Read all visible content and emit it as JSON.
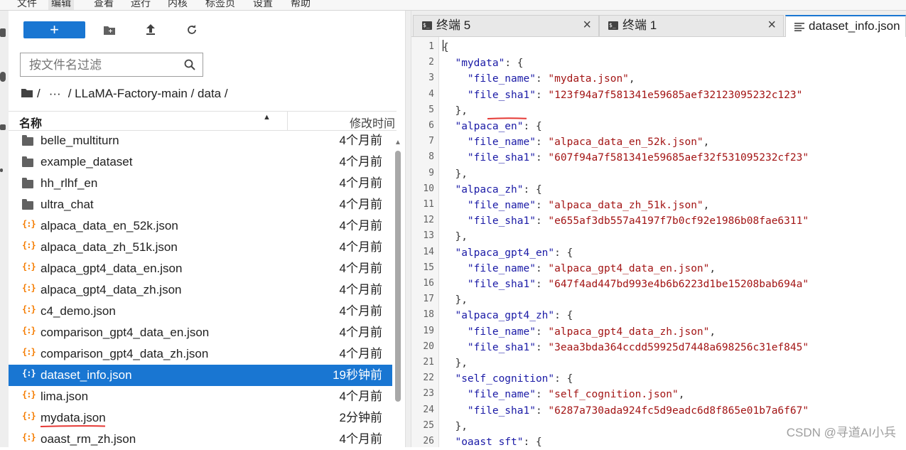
{
  "menubar": {
    "items": [
      "文件",
      "编辑",
      "查看",
      "运行",
      "内核",
      "标签页",
      "设置",
      "帮助"
    ],
    "active_index": 1
  },
  "toolbar": {
    "new_label": "+"
  },
  "filter": {
    "placeholder": "按文件名过滤"
  },
  "breadcrumb": {
    "sep1": "/",
    "ellipsis": "···",
    "path": "/ LLaMA-Factory-main / data /"
  },
  "list_header": {
    "name": "名称",
    "modified": "修改时间"
  },
  "files": [
    {
      "name": "belle_multiturn",
      "time": "4个月前",
      "type": "folder"
    },
    {
      "name": "example_dataset",
      "time": "4个月前",
      "type": "folder"
    },
    {
      "name": "hh_rlhf_en",
      "time": "4个月前",
      "type": "folder"
    },
    {
      "name": "ultra_chat",
      "time": "4个月前",
      "type": "folder"
    },
    {
      "name": "alpaca_data_en_52k.json",
      "time": "4个月前",
      "type": "json"
    },
    {
      "name": "alpaca_data_zh_51k.json",
      "time": "4个月前",
      "type": "json"
    },
    {
      "name": "alpaca_gpt4_data_en.json",
      "time": "4个月前",
      "type": "json"
    },
    {
      "name": "alpaca_gpt4_data_zh.json",
      "time": "4个月前",
      "type": "json"
    },
    {
      "name": "c4_demo.json",
      "time": "4个月前",
      "type": "json"
    },
    {
      "name": "comparison_gpt4_data_en.json",
      "time": "4个月前",
      "type": "json"
    },
    {
      "name": "comparison_gpt4_data_zh.json",
      "time": "4个月前",
      "type": "json"
    },
    {
      "name": "dataset_info.json",
      "time": "19秒钟前",
      "type": "json",
      "selected": true
    },
    {
      "name": "lima.json",
      "time": "4个月前",
      "type": "json"
    },
    {
      "name": "mydata.json",
      "time": "2分钟前",
      "type": "json",
      "underline": true
    },
    {
      "name": "oaast_rm_zh.json",
      "time": "4个月前",
      "type": "json"
    }
  ],
  "tabs": [
    {
      "label": "终端 5",
      "icon": "terminal-icon",
      "close": "×"
    },
    {
      "label": "终端 1",
      "icon": "terminal-icon",
      "close": "×"
    },
    {
      "label": "dataset_info.json",
      "icon": "document-icon",
      "active": true
    }
  ],
  "code_lines": [
    [
      [
        "p",
        "{"
      ]
    ],
    [
      [
        "p",
        "  "
      ],
      [
        "k",
        "\"mydata\""
      ],
      [
        "p",
        ": {"
      ]
    ],
    [
      [
        "p",
        "    "
      ],
      [
        "k",
        "\"file_name\""
      ],
      [
        "p",
        ": "
      ],
      [
        "s",
        "\"mydata.json\""
      ],
      [
        "p",
        ","
      ]
    ],
    [
      [
        "p",
        "    "
      ],
      [
        "k",
        "\"file_sha1\""
      ],
      [
        "p",
        ": "
      ],
      [
        "s",
        "\"123f94a7f581341e59685aef32123095232c123\""
      ]
    ],
    [
      [
        "p",
        "  },"
      ]
    ],
    [
      [
        "p",
        "  "
      ],
      [
        "k",
        "\"alpaca_en\""
      ],
      [
        "p",
        ": {"
      ]
    ],
    [
      [
        "p",
        "    "
      ],
      [
        "k",
        "\"file_name\""
      ],
      [
        "p",
        ": "
      ],
      [
        "s",
        "\"alpaca_data_en_52k.json\""
      ],
      [
        "p",
        ","
      ]
    ],
    [
      [
        "p",
        "    "
      ],
      [
        "k",
        "\"file_sha1\""
      ],
      [
        "p",
        ": "
      ],
      [
        "s",
        "\"607f94a7f581341e59685aef32f531095232cf23\""
      ]
    ],
    [
      [
        "p",
        "  },"
      ]
    ],
    [
      [
        "p",
        "  "
      ],
      [
        "k",
        "\"alpaca_zh\""
      ],
      [
        "p",
        ": {"
      ]
    ],
    [
      [
        "p",
        "    "
      ],
      [
        "k",
        "\"file_name\""
      ],
      [
        "p",
        ": "
      ],
      [
        "s",
        "\"alpaca_data_zh_51k.json\""
      ],
      [
        "p",
        ","
      ]
    ],
    [
      [
        "p",
        "    "
      ],
      [
        "k",
        "\"file_sha1\""
      ],
      [
        "p",
        ": "
      ],
      [
        "s",
        "\"e655af3db557a4197f7b0cf92e1986b08fae6311\""
      ]
    ],
    [
      [
        "p",
        "  },"
      ]
    ],
    [
      [
        "p",
        "  "
      ],
      [
        "k",
        "\"alpaca_gpt4_en\""
      ],
      [
        "p",
        ": {"
      ]
    ],
    [
      [
        "p",
        "    "
      ],
      [
        "k",
        "\"file_name\""
      ],
      [
        "p",
        ": "
      ],
      [
        "s",
        "\"alpaca_gpt4_data_en.json\""
      ],
      [
        "p",
        ","
      ]
    ],
    [
      [
        "p",
        "    "
      ],
      [
        "k",
        "\"file_sha1\""
      ],
      [
        "p",
        ": "
      ],
      [
        "s",
        "\"647f4ad447bd993e4b6b6223d1be15208bab694a\""
      ]
    ],
    [
      [
        "p",
        "  },"
      ]
    ],
    [
      [
        "p",
        "  "
      ],
      [
        "k",
        "\"alpaca_gpt4_zh\""
      ],
      [
        "p",
        ": {"
      ]
    ],
    [
      [
        "p",
        "    "
      ],
      [
        "k",
        "\"file_name\""
      ],
      [
        "p",
        ": "
      ],
      [
        "s",
        "\"alpaca_gpt4_data_zh.json\""
      ],
      [
        "p",
        ","
      ]
    ],
    [
      [
        "p",
        "    "
      ],
      [
        "k",
        "\"file_sha1\""
      ],
      [
        "p",
        ": "
      ],
      [
        "s",
        "\"3eaa3bda364ccdd59925d7448a698256c31ef845\""
      ]
    ],
    [
      [
        "p",
        "  },"
      ]
    ],
    [
      [
        "p",
        "  "
      ],
      [
        "k",
        "\"self_cognition\""
      ],
      [
        "p",
        ": {"
      ]
    ],
    [
      [
        "p",
        "    "
      ],
      [
        "k",
        "\"file_name\""
      ],
      [
        "p",
        ": "
      ],
      [
        "s",
        "\"self_cognition.json\""
      ],
      [
        "p",
        ","
      ]
    ],
    [
      [
        "p",
        "    "
      ],
      [
        "k",
        "\"file_sha1\""
      ],
      [
        "p",
        ": "
      ],
      [
        "s",
        "\"6287a730ada924fc5d9eadc6d8f865e01b7a6f67\""
      ]
    ],
    [
      [
        "p",
        "  },"
      ]
    ],
    [
      [
        "p",
        "  "
      ],
      [
        "k",
        "\"oaast_sft\""
      ],
      [
        "p",
        ": {"
      ]
    ]
  ],
  "watermark": "CSDN @寻道AI小兵",
  "colors": {
    "accent": "#1976d2",
    "json_icon": "#f57c00",
    "annotation": "#e53935"
  }
}
